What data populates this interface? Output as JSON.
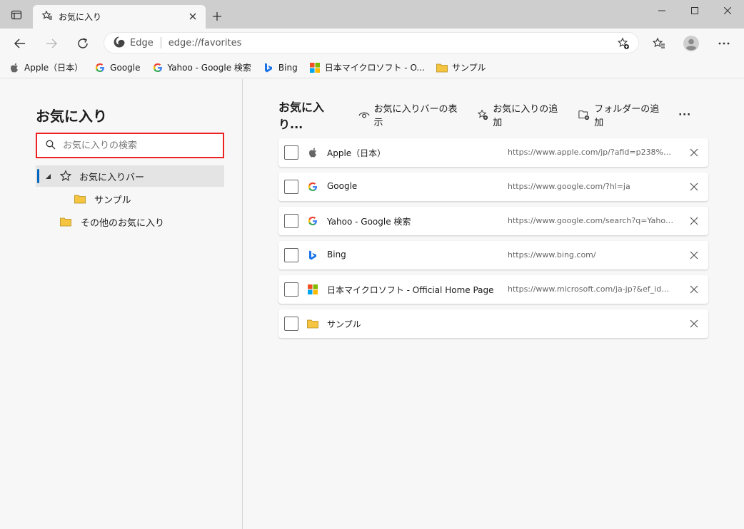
{
  "tab": {
    "title": "お気に入り"
  },
  "address_bar": {
    "brand": "Edge",
    "url": "edge://favorites"
  },
  "bookmarks_bar": [
    {
      "label": "Apple（日本）",
      "icon": "apple-icon"
    },
    {
      "label": "Google",
      "icon": "google-icon"
    },
    {
      "label": "Yahoo - Google 検索",
      "icon": "google-icon"
    },
    {
      "label": "Bing",
      "icon": "bing-icon"
    },
    {
      "label": "日本マイクロソフト - O...",
      "icon": "microsoft-icon"
    },
    {
      "label": "サンプル",
      "icon": "folder-icon"
    }
  ],
  "sidebar": {
    "title": "お気に入り",
    "search_placeholder": "お気に入りの検索",
    "tree": {
      "favorites_bar": "お気に入りバー",
      "sample_folder": "サンプル",
      "other_favorites": "その他のお気に入り"
    }
  },
  "main": {
    "title": "お気に入り...",
    "actions": {
      "show_bar": "お気に入りバーの表示",
      "add_favorite": "お気に入りの追加",
      "add_folder": "フォルダーの追加",
      "more": "···"
    },
    "items": [
      {
        "name": "Apple（日本）",
        "url": "https://www.apple.com/jp/?afid=p238%7C...",
        "icon": "apple-icon"
      },
      {
        "name": "Google",
        "url": "https://www.google.com/?hl=ja",
        "icon": "google-icon"
      },
      {
        "name": "Yahoo - Google 検索",
        "url": "https://www.google.com/search?q=Yahoo...",
        "icon": "google-icon"
      },
      {
        "name": "Bing",
        "url": "https://www.bing.com/",
        "icon": "bing-icon"
      },
      {
        "name": "日本マイクロソフト - Official Home Page",
        "url": "https://www.microsoft.com/ja-jp?&ef_id=E...",
        "icon": "microsoft-icon"
      },
      {
        "name": "サンプル",
        "url": "",
        "icon": "folder-icon"
      }
    ]
  },
  "colors": {
    "accent": "#0067c0",
    "highlight_border": "#e22222",
    "folder": "#f5c542"
  }
}
